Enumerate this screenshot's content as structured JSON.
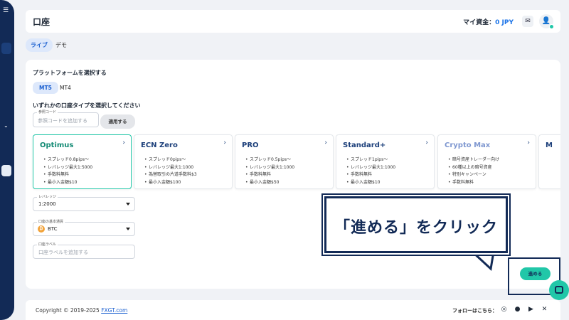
{
  "header": {
    "title": "口座",
    "fund_label": "マイ資金：",
    "fund_amount": "0 JPY"
  },
  "mode_tabs": [
    "ライブ",
    "デモ"
  ],
  "platform": {
    "heading": "プラットフォームを選択する",
    "options": [
      "MT5",
      "MT4"
    ]
  },
  "account_type": {
    "heading": "いずれかの口座タイプを選択してください",
    "ref_code_label": "参照コード",
    "ref_code_placeholder": "参照コードを追加する",
    "apply_label": "適用する",
    "cards": [
      {
        "name": "Optimus",
        "features": [
          "スプレッド0.8pips〜",
          "レバレッジ最大1:5000",
          "手数料無料",
          "最小入金額$10"
        ]
      },
      {
        "name": "ECN Zero",
        "features": [
          "スプレッド0pips〜",
          "レバレッジ最大1:1000",
          "為替取引の片道手数料$3",
          "最小入金額$100"
        ]
      },
      {
        "name": "PRO",
        "features": [
          "スプレッド0.5pips〜",
          "レバレッジ最大1:1000",
          "手数料無料",
          "最小入金額$50"
        ]
      },
      {
        "name": "Standard+",
        "features": [
          "スプレッド1pips〜",
          "レバレッジ最大1:1000",
          "手数料無料",
          "最小入金額$10"
        ]
      },
      {
        "name": "Crypto Max",
        "features": [
          "暗号資産トレーダー向け",
          "60種以上の暗号資産",
          "特別キャンペーン",
          "手数料無料"
        ]
      },
      {
        "name": "M"
      }
    ]
  },
  "form": {
    "leverage_label": "レバレッジ",
    "leverage_value": "1:2000",
    "currency_label": "口座の基本通貨",
    "currency_value": "BTC",
    "account_label_label": "口座ラベル",
    "account_label_placeholder": "口座ラベルを追加する"
  },
  "callout": "「進める」をクリック",
  "next_label": "進める",
  "footer": {
    "copyright": "Copyright © 2019-2025 ",
    "link": "FXGT.com",
    "follow": "フォローはこちら："
  },
  "icons": [
    "menu-icon",
    "mail-icon",
    "user-icon",
    "arrow-right-icon",
    "caret-down-icon",
    "btc-icon",
    "chat-icon",
    "instagram-icon",
    "facebook-icon",
    "youtube-icon",
    "x-icon"
  ],
  "colors": {
    "sidebar": "#122a56",
    "accent": "#21c7a8",
    "primary": "#1a5fd0",
    "callout_text": "#122a56"
  }
}
